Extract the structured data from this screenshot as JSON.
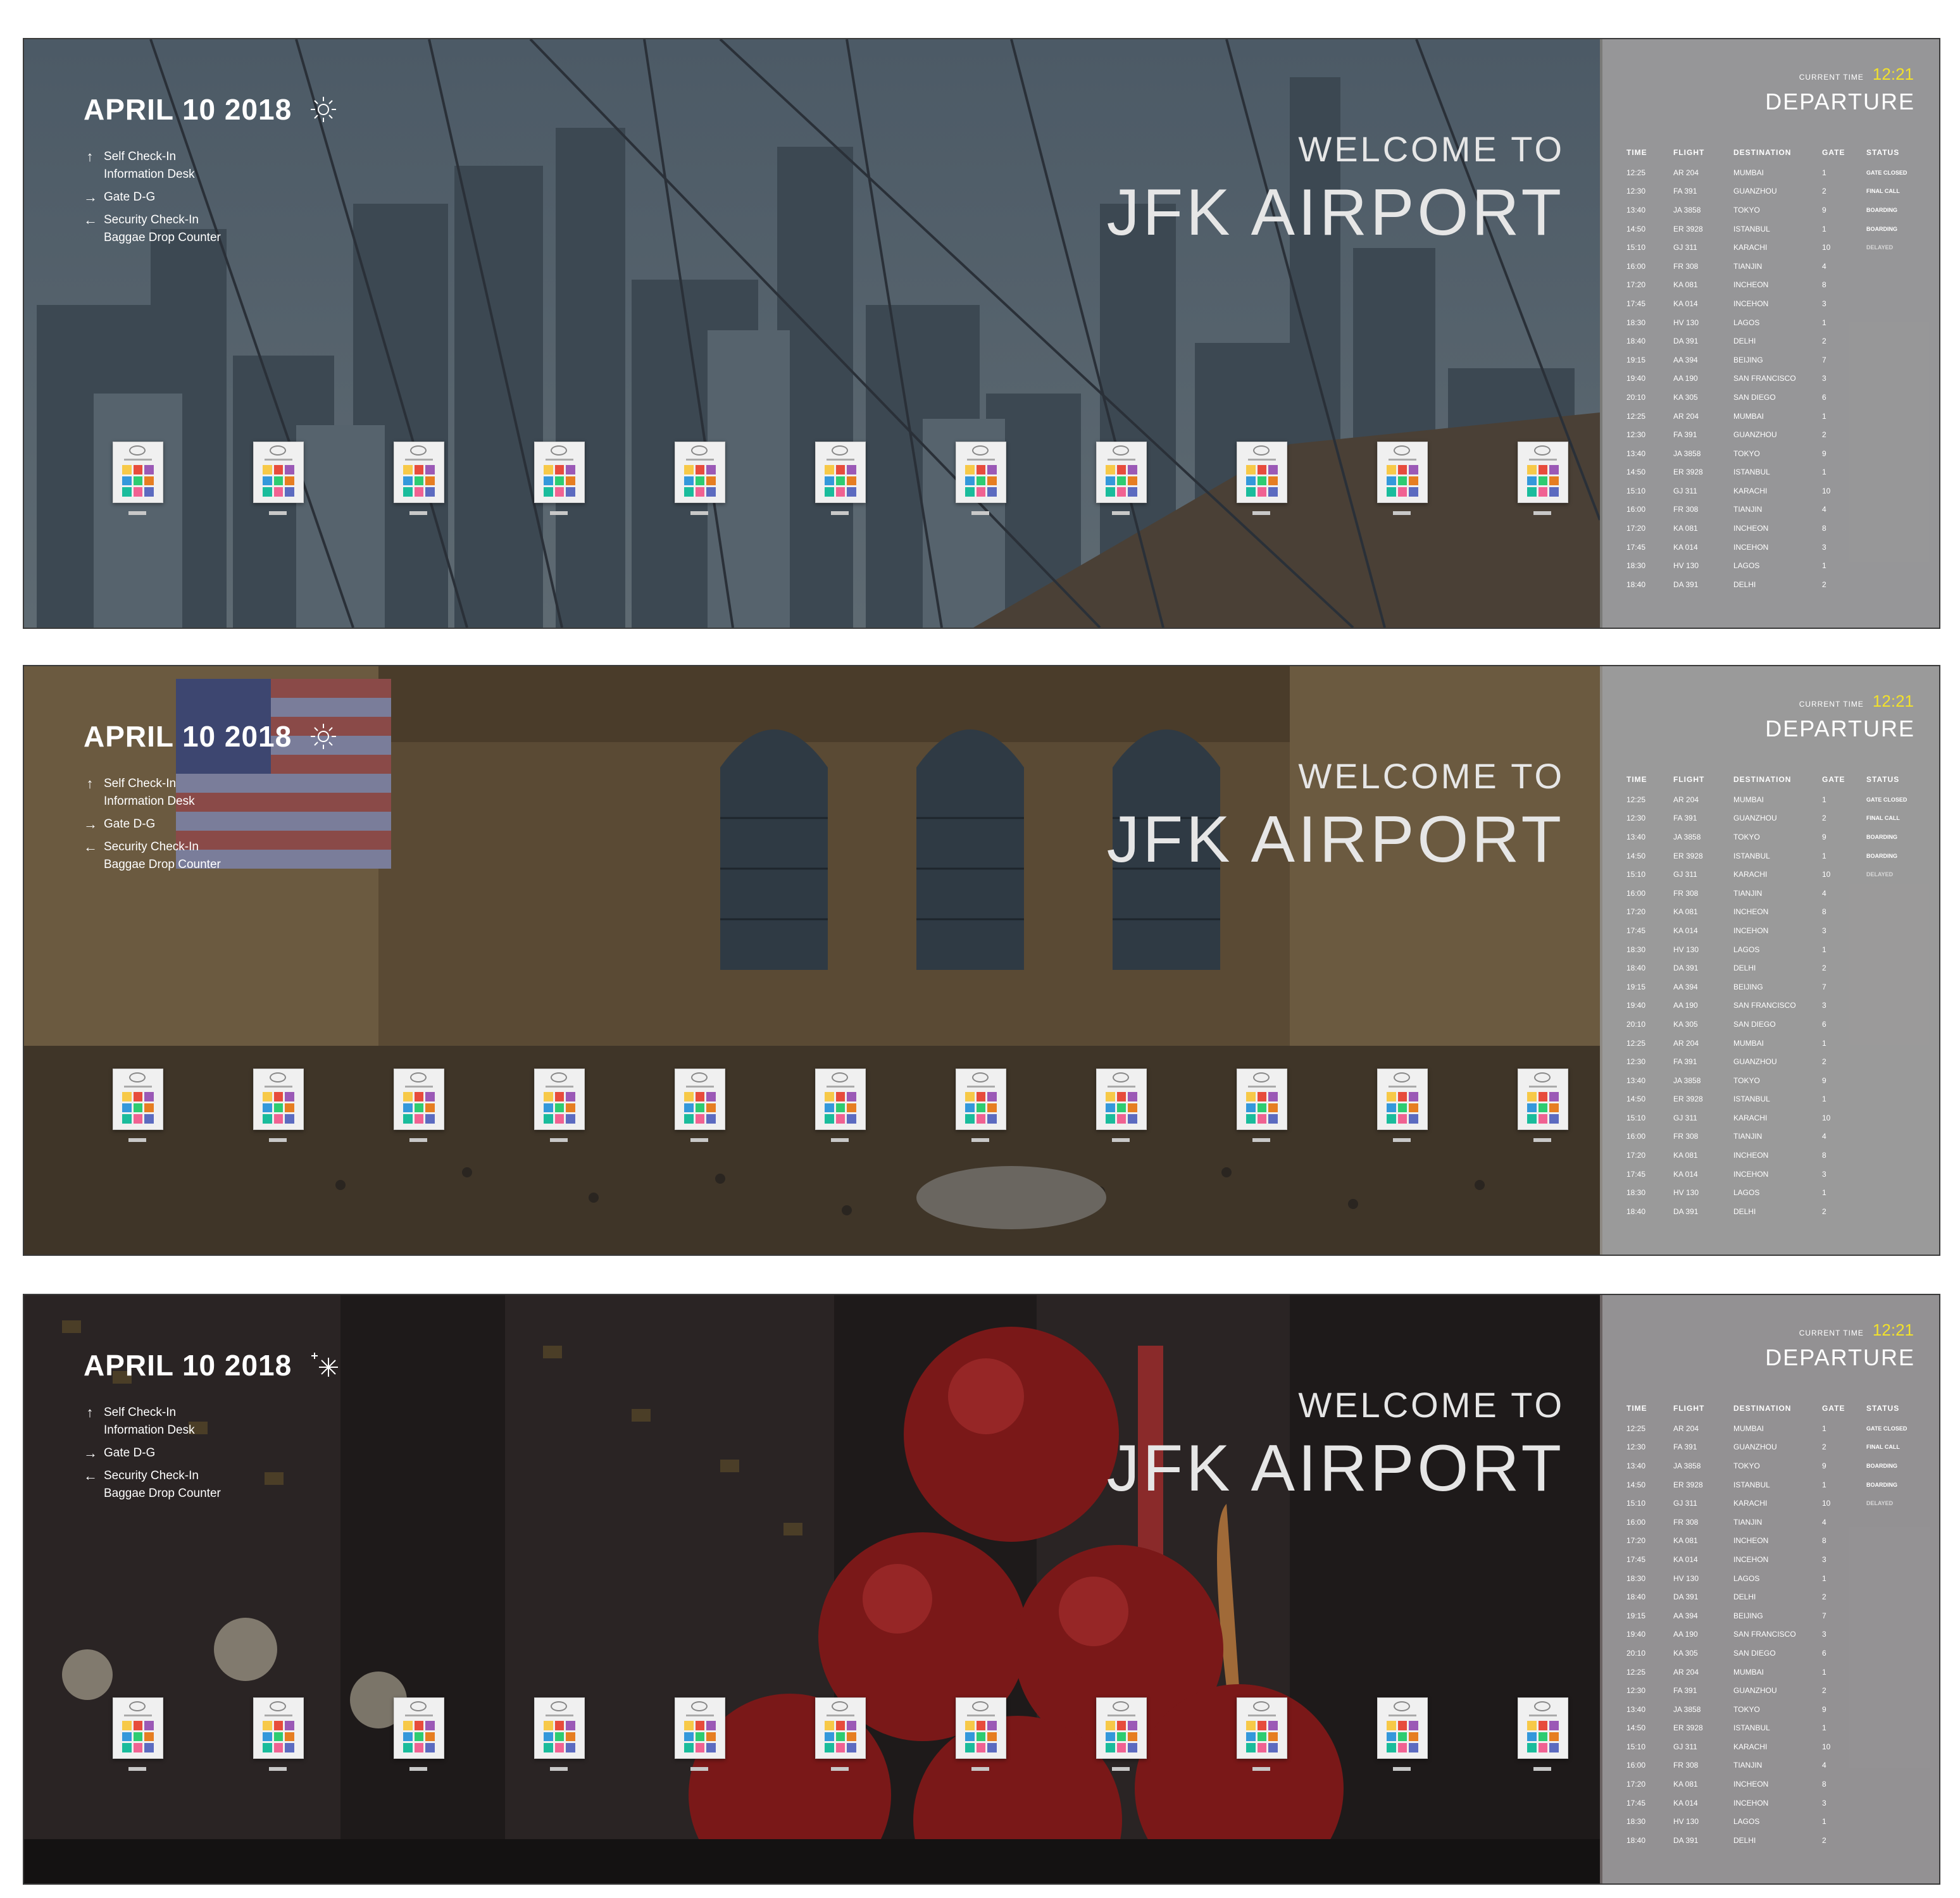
{
  "date": "APRIL 10 2018",
  "nav": [
    {
      "icon": "arrow-up-icon",
      "lines": [
        "Self Check-In",
        "Information Desk"
      ]
    },
    {
      "icon": "arrow-right-icon",
      "lines": [
        "Gate D-G"
      ]
    },
    {
      "icon": "arrow-left-icon",
      "lines": [
        "Security Check-In",
        "Baggae Drop Counter"
      ]
    }
  ],
  "welcome": {
    "line1": "WELCOME TO",
    "line2": "JFK AIRPORT"
  },
  "board": {
    "current_time_label": "CURRENT TIME",
    "current_time": "12:21",
    "title": "DEPARTURE",
    "columns": [
      "TIME",
      "FLIGHT",
      "DESTINATION",
      "GATE",
      "STATUS"
    ],
    "rows": [
      [
        "12:25",
        "AR 204",
        "MUMBAI",
        "1",
        "GATE CLOSED"
      ],
      [
        "12:30",
        "FA 391",
        "GUANZHOU",
        "2",
        "FINAL CALL"
      ],
      [
        "13:40",
        "JA 3858",
        "TOKYO",
        "9",
        "BOARDING"
      ],
      [
        "14:50",
        "ER 3928",
        "ISTANBUL",
        "1",
        "BOARDING"
      ],
      [
        "15:10",
        "GJ 311",
        "KARACHI",
        "10",
        "DELAYED"
      ],
      [
        "16:00",
        "FR 308",
        "TIANJIN",
        "4",
        ""
      ],
      [
        "17:20",
        "KA 081",
        "INCHEON",
        "8",
        ""
      ],
      [
        "17:45",
        "KA 014",
        "INCEHON",
        "3",
        ""
      ],
      [
        "18:30",
        "HV 130",
        "LAGOS",
        "1",
        ""
      ],
      [
        "18:40",
        "DA 391",
        "DELHI",
        "2",
        ""
      ],
      [
        "19:15",
        "AA 394",
        "BEIJING",
        "7",
        ""
      ],
      [
        "19:40",
        "AA 190",
        "SAN FRANCISCO",
        "3",
        ""
      ],
      [
        "20:10",
        "KA 305",
        "SAN DIEGO",
        "6",
        ""
      ],
      [
        "12:25",
        "AR 204",
        "MUMBAI",
        "1",
        ""
      ],
      [
        "12:30",
        "FA 391",
        "GUANZHOU",
        "2",
        ""
      ],
      [
        "13:40",
        "JA 3858",
        "TOKYO",
        "9",
        ""
      ],
      [
        "14:50",
        "ER 3928",
        "ISTANBUL",
        "1",
        ""
      ],
      [
        "15:10",
        "GJ 311",
        "KARACHI",
        "10",
        ""
      ],
      [
        "16:00",
        "FR 308",
        "TIANJIN",
        "4",
        ""
      ],
      [
        "17:20",
        "KA 081",
        "INCHEON",
        "8",
        ""
      ],
      [
        "17:45",
        "KA 014",
        "INCEHON",
        "3",
        ""
      ],
      [
        "18:30",
        "HV 130",
        "LAGOS",
        "1",
        ""
      ],
      [
        "18:40",
        "DA 391",
        "DELHI",
        "2",
        ""
      ]
    ],
    "status_colors": {
      "GATE CLOSED": "#ffffff",
      "FINAL CALL": "#ffffff",
      "BOARDING": "#ffffff",
      "DELAYED": "#d8d8d8"
    }
  },
  "panels": [
    {
      "scene": "bridge-skyline",
      "weather_icon": "sun-icon"
    },
    {
      "scene": "grand-central-terminal",
      "weather_icon": "sun-icon"
    },
    {
      "scene": "night-christmas-ornaments",
      "weather_icon": "sparkle-icon"
    }
  ],
  "kiosk_count": 11,
  "kiosk_colors": [
    "#f7c948",
    "#e74c3c",
    "#9b59b6",
    "#3498db",
    "#2ecc71",
    "#e67e22",
    "#1abc9c",
    "#f06292",
    "#5c6bc0"
  ]
}
